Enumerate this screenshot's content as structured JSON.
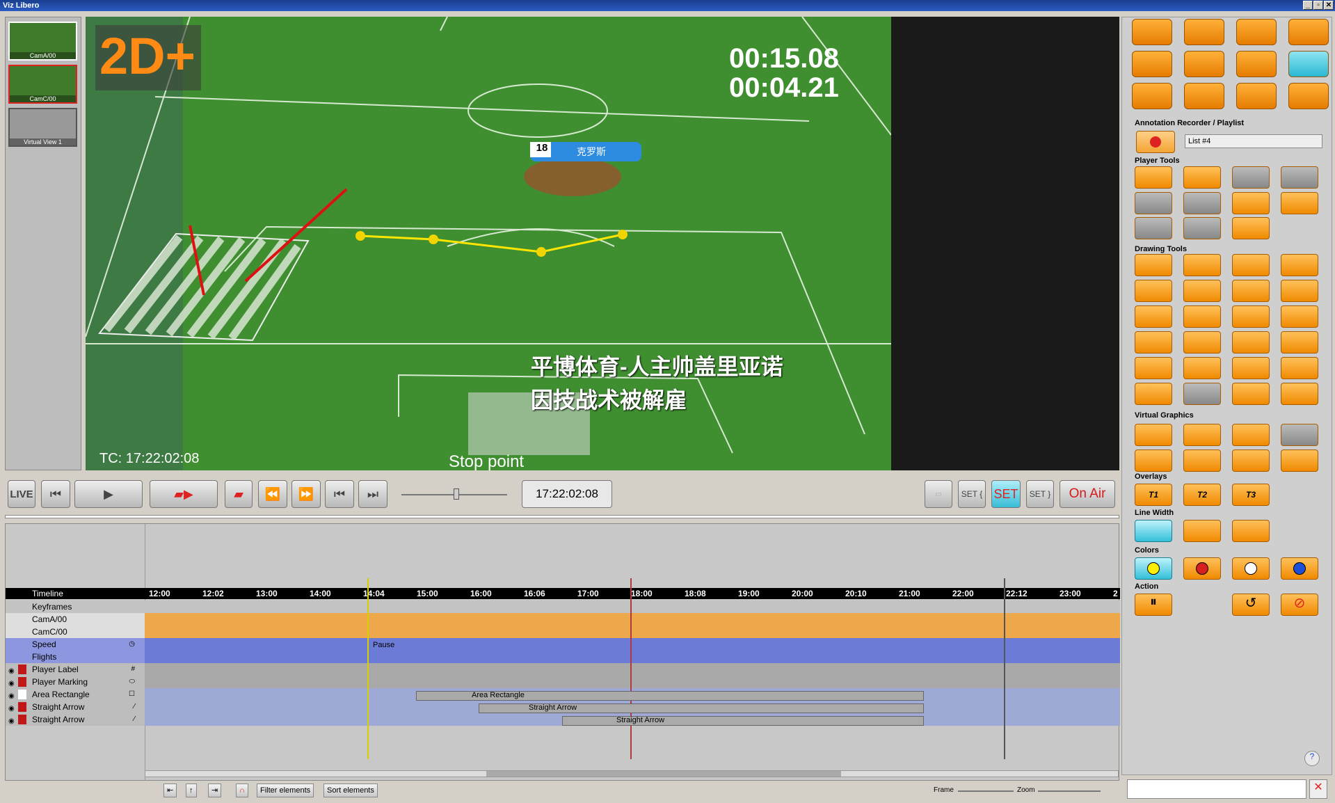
{
  "window": {
    "title": "Viz Libero",
    "buttons": [
      "_",
      "▫",
      "✕"
    ]
  },
  "thumbnails": [
    {
      "label": "CamA/00"
    },
    {
      "label": "CamC/00"
    },
    {
      "label": "Virtual View 1"
    }
  ],
  "video": {
    "mode_badge": "2D+",
    "clock_1": "00:15.08",
    "clock_2": "00:04.21",
    "player_number": "18",
    "player_name": "克罗斯",
    "headline_1": "平博体育-人主帅盖里亚诺",
    "headline_2": "因技战术被解雇",
    "tc": "TC: 17:22:02:08",
    "stop_point": "Stop point"
  },
  "transport": {
    "live": "LIVE",
    "timecode": "17:22:02:08",
    "on_air": "On Air",
    "set_labels": [
      "SET {",
      "SET",
      "SET }"
    ],
    "scrub_position": 0.5
  },
  "timeline": {
    "header": "Timeline",
    "ticks": [
      "12:00",
      "12:02",
      "13:00",
      "14:00",
      "14:04",
      "15:00",
      "16:00",
      "16:06",
      "17:00",
      "18:00",
      "18:08",
      "19:00",
      "20:00",
      "20:10",
      "21:00",
      "22:00",
      "22:12",
      "23:00",
      "2"
    ],
    "rows": [
      {
        "label": "Keyframes",
        "icon": ""
      },
      {
        "label": "CamA/00",
        "icon": ""
      },
      {
        "label": "CamC/00",
        "icon": ""
      },
      {
        "label": "Speed",
        "icon": "◷"
      },
      {
        "label": "Flights",
        "icon": ""
      },
      {
        "label": "Player Label",
        "icon": "#"
      },
      {
        "label": "Player Marking",
        "icon": "⬭"
      },
      {
        "label": "Area Rectangle",
        "icon": "☐"
      },
      {
        "label": "Straight Arrow",
        "icon": "⁄"
      },
      {
        "label": "Straight Arrow",
        "icon": "⁄"
      }
    ],
    "clips": {
      "pause": "Pause",
      "area_rect": "Area Rectangle",
      "arrow1": "Straight Arrow",
      "arrow2": "Straight Arrow"
    }
  },
  "status": {
    "filter": "Filter elements",
    "sort": "Sort elements",
    "frame": "Frame",
    "zoom": "Zoom"
  },
  "sidebar": {
    "sections": {
      "recorder": "Annotation Recorder / Playlist",
      "player_tools": "Player Tools",
      "drawing_tools": "Drawing Tools",
      "virtual_graphics": "Virtual Graphics",
      "overlays": "Overlays",
      "line_width": "Line Width",
      "colors": "Colors",
      "action": "Action"
    },
    "playlist": "List #4",
    "overlay_labels": [
      "T1",
      "T2",
      "T3"
    ],
    "color_values": [
      "#ffee00",
      "#d62020",
      "#ffffff",
      "#1d4fd6"
    ]
  }
}
